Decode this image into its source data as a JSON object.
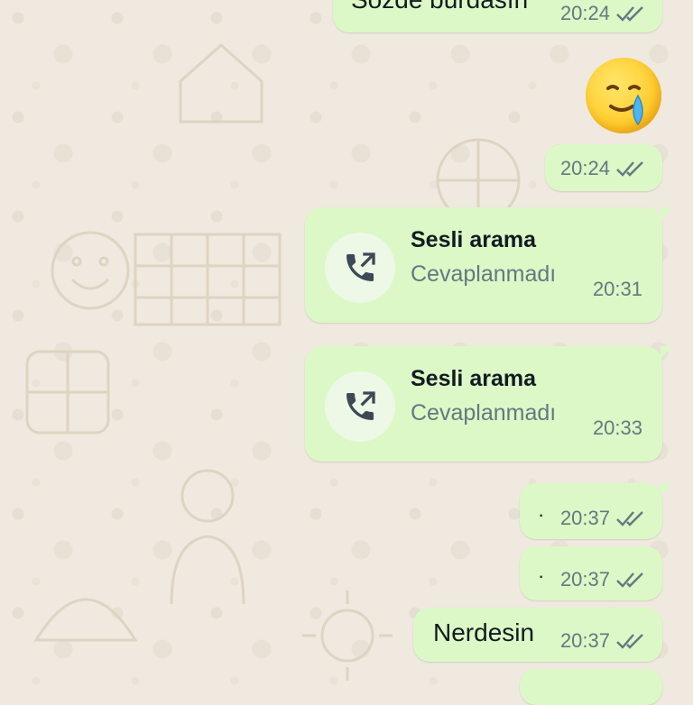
{
  "messages": [
    {
      "text": "Sözde burdasın",
      "time": "20:24"
    },
    {
      "emoji": "face-holding-back-tears",
      "time": "20:24"
    },
    {
      "call_title": "Sesli arama",
      "call_status": "Cevaplanmadı",
      "time": "20:31"
    },
    {
      "call_title": "Sesli arama",
      "call_status": "Cevaplanmadı",
      "time": "20:33"
    },
    {
      "text": "·",
      "time": "20:37"
    },
    {
      "text": "·",
      "time": "20:37"
    },
    {
      "text": "Nerdesin",
      "time": "20:37"
    }
  ],
  "icons": {
    "read_receipt": "double-check-icon",
    "call": "outgoing-call-icon"
  },
  "colors": {
    "bubble": "#dcf8c6",
    "background": "#efe9df",
    "meta": "#667781"
  }
}
